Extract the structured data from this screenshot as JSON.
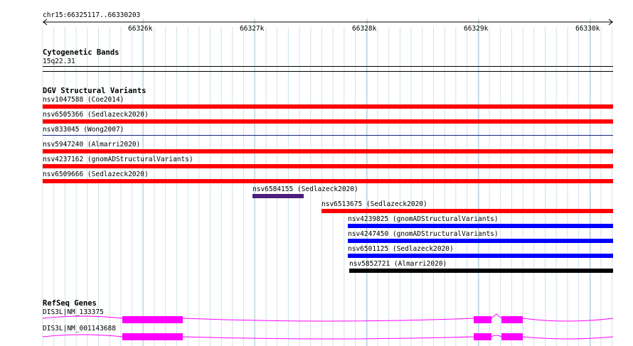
{
  "ruler": {
    "region": "chr15:66325117..66330203",
    "ticks": [
      "66326k",
      "66327k",
      "66328k",
      "66329k",
      "66330k"
    ]
  },
  "tracks": {
    "cytogenetic": {
      "title": "Cytogenetic Bands",
      "band": "15q22.31"
    },
    "dgv": {
      "title": "DGV Structural Variants",
      "features": [
        {
          "label": "nsv1047588 (Coe2014)",
          "color": "#ff0000"
        },
        {
          "label": "nsv6505366 (Sedlazeck2020)",
          "color": "#ff0000"
        },
        {
          "label": "nsv833045 (Wong2007)",
          "color": "#1a237e"
        },
        {
          "label": "nsv5947240 (Almarri2020)",
          "color": "#ff0000"
        },
        {
          "label": "nsv4237162 (gnomADStructuralVariants)",
          "color": "#ff0000"
        },
        {
          "label": "nsv6509666 (Sedlazeck2020)",
          "color": "#ff0000"
        },
        {
          "label": "nsv6584155 (Sedlazeck2020)",
          "color": "#4b1f7a"
        },
        {
          "label": "nsv6513675 (Sedlazeck2020)",
          "color": "#ff0000"
        },
        {
          "label": "nsv4239825 (gnomADStructuralVariants)",
          "color": "#0000ff"
        },
        {
          "label": "nsv4247450 (gnomADStructuralVariants)",
          "color": "#0000ff"
        },
        {
          "label": "nsv6501125 (Sedlazeck2020)",
          "color": "#0000ff"
        },
        {
          "label": "nsv5852721 (Almarri2020)",
          "color": "#000000"
        }
      ]
    },
    "refseq": {
      "title": "RefSeq Genes",
      "genes": [
        {
          "label": "DIS3L|NM_133375",
          "color": "#ff00ff"
        },
        {
          "label": "DIS3L|NM_001143688",
          "color": "#ff00ff"
        }
      ]
    }
  }
}
